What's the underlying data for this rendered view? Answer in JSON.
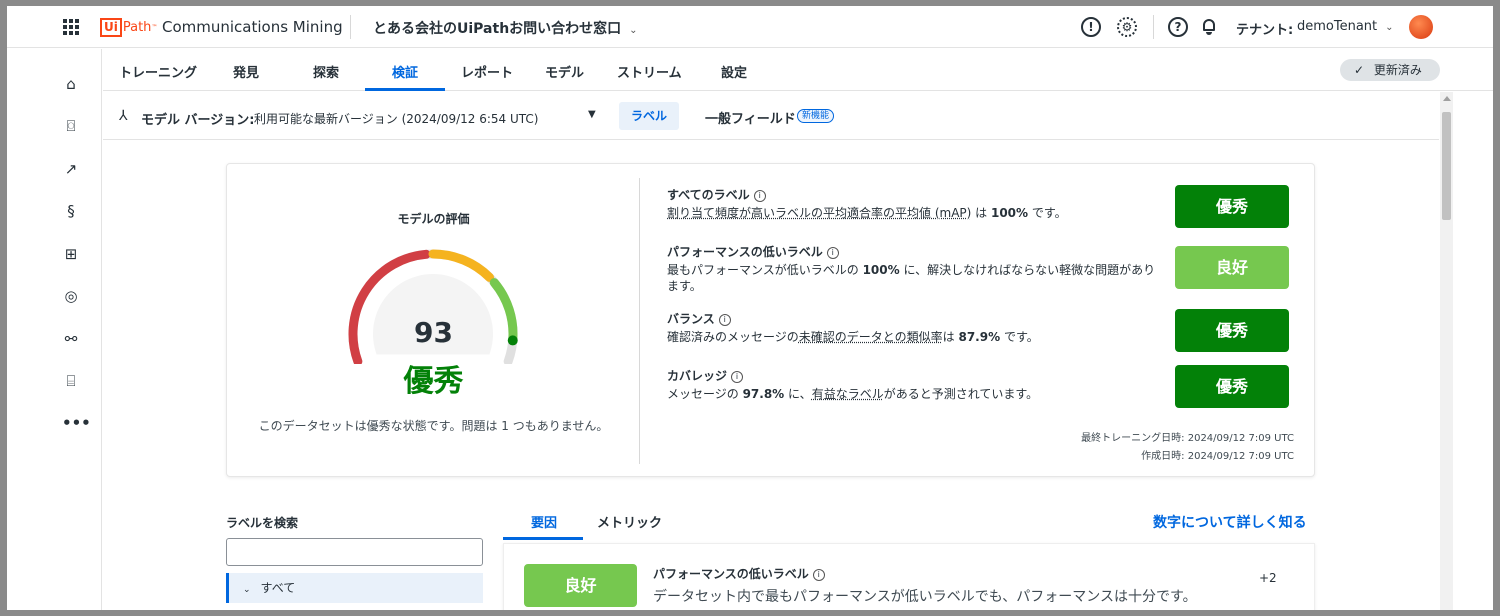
{
  "header": {
    "app_logo_box": "Ui",
    "app_logo_path": "Path",
    "app_logo_tm": "™",
    "app_name": "Communications Mining",
    "context": "とある会社のUiPathお問い合わせ窓口",
    "tenant_label": "テナント:",
    "tenant_value": "demoTenant",
    "icons": [
      "apps-grid-icon",
      "alert-icon",
      "settings-icon",
      "help-icon",
      "bell-icon",
      "avatar"
    ]
  },
  "rail": {
    "items": [
      "home-icon",
      "dataset-icon",
      "chart-icon",
      "stream-icon",
      "apps-icon",
      "alert-icon",
      "integration-icon",
      "store-icon",
      "more-icon"
    ]
  },
  "tabs": {
    "items": [
      "トレーニング",
      "発見",
      "探索",
      "検証",
      "レポート",
      "モデル",
      "ストリーム",
      "設定"
    ],
    "active": "検証",
    "updated_chip": "更新済み"
  },
  "version_bar": {
    "label": "モデル バージョン:",
    "value": "利用可能な最新バージョン (2024/09/12 6:54 UTC)",
    "labels_toggle": "ラベル",
    "general_fields": "一般フィールド",
    "new_badge": "新機能"
  },
  "rating": {
    "title": "モデルの評価",
    "score": "93",
    "grade": "優秀",
    "score_fraction": 0.93,
    "description": "このデータセットは優秀な状態です。問題は 1 つもありません。",
    "colors": {
      "red": "#d13f44",
      "orange": "#f5b31f",
      "green": "#76c84f",
      "excellent": "#038108"
    }
  },
  "metrics": [
    {
      "title": "すべてのラベル",
      "desc_parts": [
        "割り当て頻度が高いラベルの平均適合率の平均値 (mAP)",
        " は ",
        "100%",
        " です。"
      ],
      "rating": "優秀"
    },
    {
      "title": "パフォーマンスの低いラベル",
      "desc_parts": [
        "最もパフォーマンスが低いラベルの ",
        "100%",
        " に、",
        "解決しなければならない軽微な問題があります。"
      ],
      "rating": "良好"
    },
    {
      "title": "バランス",
      "desc_parts": [
        "確認済みのメッセージの",
        "未確認のデータとの類似率",
        "は ",
        "87.9%",
        " です。"
      ],
      "rating": "優秀"
    },
    {
      "title": "カバレッジ",
      "desc_parts": [
        "メッセージの ",
        "97.8%",
        " に、",
        "有益なラベル",
        "があると予測されています。"
      ],
      "rating": "優秀"
    }
  ],
  "training": {
    "last_trained": "最終トレーニング日時: 2024/09/12 7:09 UTC",
    "created": "作成日時: 2024/09/12 7:09 UTC"
  },
  "lower": {
    "search_label": "ラベルを検索",
    "search_value": "",
    "all_item": "すべて",
    "sub_tabs": [
      "要因",
      "メトリック"
    ],
    "learn_more": "数字について詳しく知る",
    "factor": {
      "rating": "良好",
      "title": "パフォーマンスの低いラベル",
      "desc": "データセット内で最もパフォーマンスが低いラベルでも、パフォーマンスは十分です。",
      "extra": "+2"
    }
  }
}
